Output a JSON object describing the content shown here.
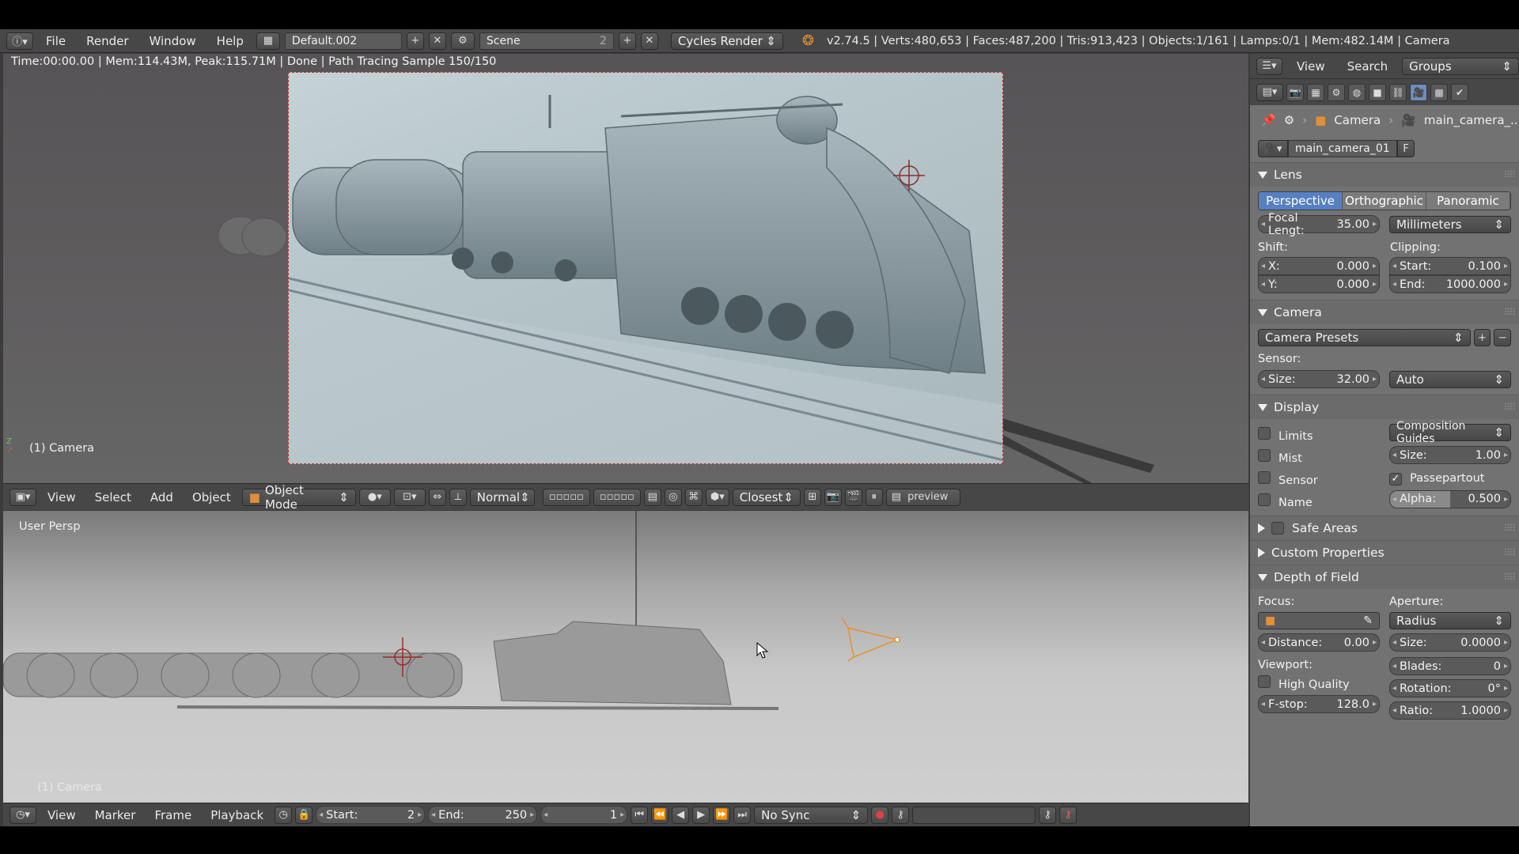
{
  "topbar": {
    "menus": [
      "File",
      "Render",
      "Window",
      "Help"
    ],
    "layout_name": "Default.002",
    "scene_name": "Scene",
    "scene_users": "2",
    "render_engine": "Cycles Render",
    "stats": "v2.74.5 | Verts:480,653 | Faces:487,200 | Tris:913,423 | Objects:1/161 | Lamps:0/1 | Mem:482.14M | Camera"
  },
  "viewport_top": {
    "render_info": "Time:00:00.00 | Mem:114.43M, Peak:115.71M | Done | Path Tracing Sample 150/150",
    "object_label": "(1) Camera"
  },
  "viewport_header": {
    "menus": [
      "View",
      "Select",
      "Add",
      "Object"
    ],
    "mode": "Object Mode",
    "pivot": "Normal",
    "snap": "Closest",
    "render_layer": "preview"
  },
  "viewport_bottom": {
    "view_label": "User Persp",
    "object_label": "(1) Camera"
  },
  "timeline": {
    "menus": [
      "View",
      "Marker",
      "Frame",
      "Playback"
    ],
    "start_label": "Start:",
    "start_value": "2",
    "end_label": "End:",
    "end_value": "250",
    "current_frame": "1",
    "sync": "No Sync"
  },
  "properties": {
    "header_menus": [
      "View",
      "Search"
    ],
    "groups_dropdown": "Groups",
    "breadcrumb": [
      "Camera",
      "main_camera_..."
    ],
    "datablock_name": "main_camera_01",
    "fake_user": "F",
    "lens": {
      "title": "Lens",
      "types": [
        "Perspective",
        "Orthographic",
        "Panoramic"
      ],
      "focal_label": "Focal Lengt:",
      "focal_value": "35.00",
      "unit": "Millimeters",
      "shift_label": "Shift:",
      "clip_label": "Clipping:",
      "shift_x_label": "X:",
      "shift_x": "0.000",
      "shift_y_label": "Y:",
      "shift_y": "0.000",
      "clip_start_label": "Start:",
      "clip_start": "0.100",
      "clip_end_label": "End:",
      "clip_end": "1000.000"
    },
    "camera": {
      "title": "Camera",
      "presets": "Camera Presets",
      "sensor_label": "Sensor:",
      "size_label": "Size:",
      "size_value": "32.00",
      "fit": "Auto"
    },
    "display": {
      "title": "Display",
      "checks": [
        "Limits",
        "Mist",
        "Sensor",
        "Name"
      ],
      "guides": "Composition Guides",
      "size_label": "Size:",
      "size_value": "1.00",
      "passepartout": "Passepartout",
      "alpha_label": "Alpha:",
      "alpha_value": "0.500"
    },
    "safe_areas": "Safe Areas",
    "custom_properties": "Custom Properties",
    "dof": {
      "title": "Depth of Field",
      "focus_label": "Focus:",
      "aperture_label": "Aperture:",
      "aperture_type": "Radius",
      "distance_label": "Distance:",
      "distance_value": "0.00",
      "size_label": "Size:",
      "size_value": "0.0000",
      "viewport_label": "Viewport:",
      "blades_label": "Blades:",
      "blades_value": "0",
      "high_quality": "High Quality",
      "rotation_label": "Rotation:",
      "rotation_value": "0°",
      "fstop_label": "F-stop:",
      "fstop_value": "128.0",
      "ratio_label": "Ratio:",
      "ratio_value": "1.0000"
    }
  }
}
